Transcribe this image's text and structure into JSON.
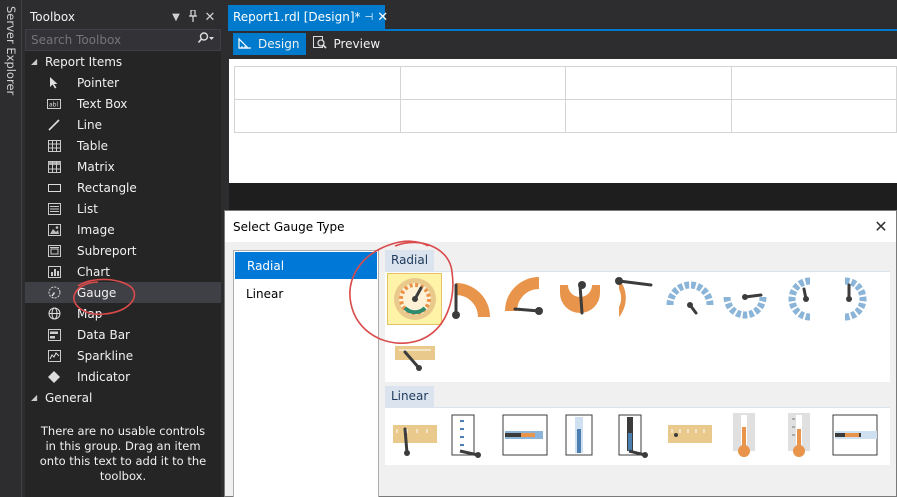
{
  "server_explorer": {
    "label": "Server Explorer"
  },
  "toolbox": {
    "title": "Toolbox",
    "search_placeholder": "Search Toolbox",
    "groups": [
      {
        "label": "Report Items",
        "expanded": true
      },
      {
        "label": "General",
        "expanded": true
      }
    ],
    "items": [
      {
        "label": "Pointer",
        "icon": "pointer-icon"
      },
      {
        "label": "Text Box",
        "icon": "textbox-icon"
      },
      {
        "label": "Line",
        "icon": "line-icon"
      },
      {
        "label": "Table",
        "icon": "table-icon"
      },
      {
        "label": "Matrix",
        "icon": "matrix-icon"
      },
      {
        "label": "Rectangle",
        "icon": "rectangle-icon"
      },
      {
        "label": "List",
        "icon": "list-icon"
      },
      {
        "label": "Image",
        "icon": "image-icon"
      },
      {
        "label": "Subreport",
        "icon": "subreport-icon"
      },
      {
        "label": "Chart",
        "icon": "chart-icon"
      },
      {
        "label": "Gauge",
        "icon": "gauge-icon",
        "selected": true
      },
      {
        "label": "Map",
        "icon": "map-icon"
      },
      {
        "label": "Data Bar",
        "icon": "databar-icon"
      },
      {
        "label": "Sparkline",
        "icon": "sparkline-icon"
      },
      {
        "label": "Indicator",
        "icon": "indicator-icon"
      }
    ],
    "general_empty_text": "There are no usable controls in this group. Drag an item onto this text to add it to the toolbox."
  },
  "document": {
    "tab_title": "Report1.rdl [Design]*",
    "subtabs": [
      {
        "label": "Design",
        "active": true
      },
      {
        "label": "Preview",
        "active": false
      }
    ]
  },
  "dialog": {
    "title": "Select Gauge Type",
    "types": [
      {
        "label": "Radial",
        "selected": true
      },
      {
        "label": "Linear",
        "selected": false
      }
    ],
    "sections": [
      {
        "label": "Radial"
      },
      {
        "label": "Linear"
      }
    ]
  },
  "colors": {
    "accent": "#007acc",
    "gauge_orange": "#e8944a",
    "gauge_blue": "#8ab4d8",
    "gauge_tan": "#e9c98c",
    "needle": "#3c3c3c"
  }
}
